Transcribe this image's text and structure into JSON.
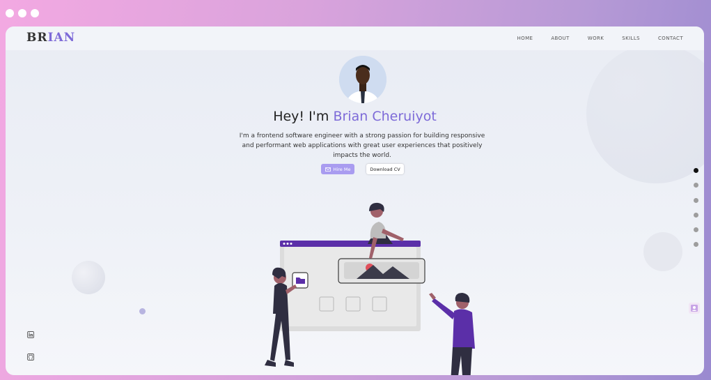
{
  "browser": {
    "window_controls": [
      "dot",
      "dot",
      "dot"
    ]
  },
  "header": {
    "logo_part1": "BR",
    "logo_part2": "IAN",
    "nav": [
      "HOME",
      "ABOUT",
      "WORK",
      "SKILLS",
      "CONTACT"
    ]
  },
  "hero": {
    "greeting": "Hey! I'm",
    "name": "Brian Cheruiyot",
    "description": "I'm a frontend software engineer with a strong passion for building responsive and performant web applications with great user experiences that positively impacts the world.",
    "hire_label": "Hire Me",
    "cv_label": "Download CV"
  },
  "side_nav": {
    "count": 6,
    "active_index": 0
  },
  "social": {
    "icons": [
      "linkedin-icon",
      "github-icon"
    ]
  },
  "colors": {
    "accent": "#7d6ad8",
    "button_primary": "#a99cf0",
    "illustration_bar": "#5b2fa8"
  }
}
